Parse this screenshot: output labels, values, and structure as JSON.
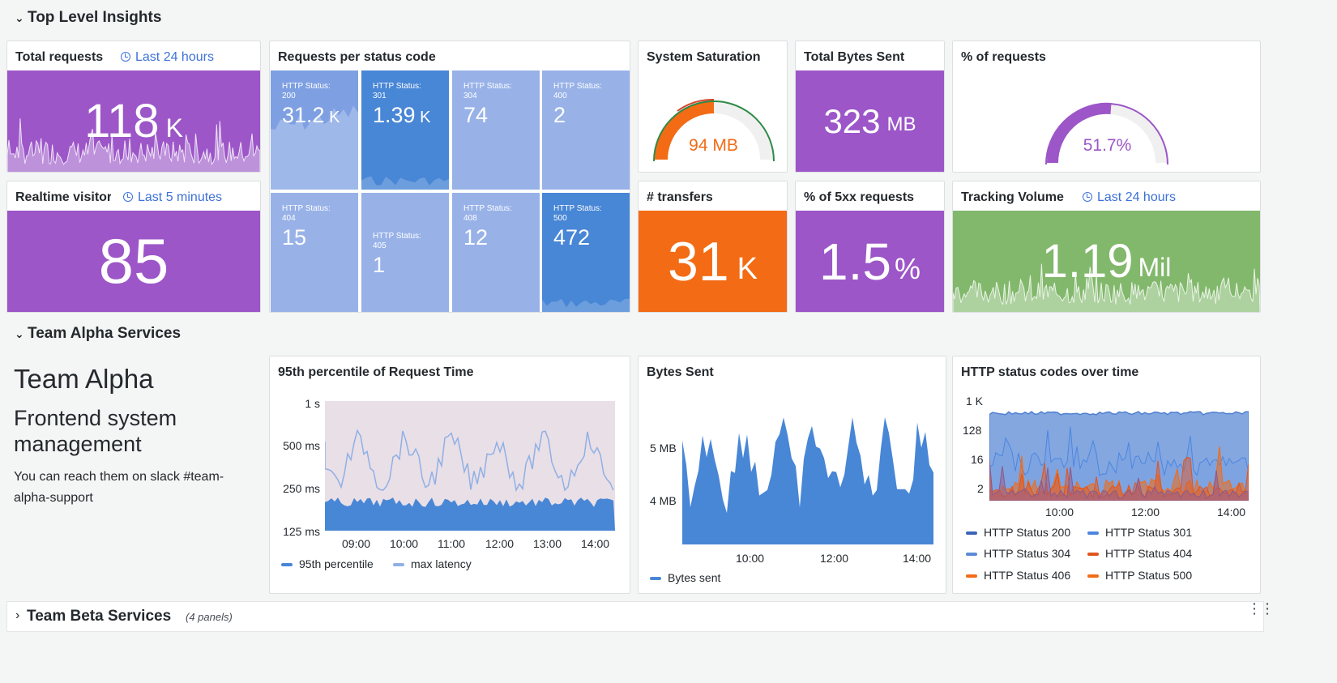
{
  "rows": {
    "top": "Top Level Insights",
    "alpha": "Team Alpha Services",
    "beta": "Team Beta Services",
    "beta_count": "(4 panels)"
  },
  "colors": {
    "purple": "#9c56c8",
    "orange": "#f36b14",
    "green": "#82b86c",
    "blue_dark": "#4886d6",
    "blue_light": "#98b2e8",
    "link_blue": "#3d71d9"
  },
  "panels": {
    "total_requests": {
      "title": "Total requests",
      "time": "Last 24 hours",
      "value": "118",
      "unit": "K"
    },
    "realtime": {
      "title": "Realtime visitors",
      "time": "Last 5 minutes",
      "value": "85"
    },
    "status_codes": {
      "title": "Requests per status code",
      "tiles": [
        {
          "label": "HTTP Status:",
          "code": "200",
          "value": "31.2",
          "unit": "K"
        },
        {
          "label": "HTTP Status:",
          "code": "301",
          "value": "1.39",
          "unit": "K"
        },
        {
          "label": "HTTP Status:",
          "code": "304",
          "value": "74",
          "unit": ""
        },
        {
          "label": "HTTP Status:",
          "code": "400",
          "value": "2",
          "unit": ""
        },
        {
          "label": "HTTP Status:",
          "code": "404",
          "value": "15",
          "unit": ""
        },
        {
          "label": "HTTP Status:",
          "code": "405",
          "value": "1",
          "unit": ""
        },
        {
          "label": "HTTP Status:",
          "code": "408",
          "value": "12",
          "unit": ""
        },
        {
          "label": "HTTP Status:",
          "code": "500",
          "value": "472",
          "unit": ""
        }
      ]
    },
    "saturation": {
      "title": "System Saturation",
      "value": "94 MB"
    },
    "bytes_total": {
      "title": "Total Bytes Sent",
      "value": "323",
      "unit": "MB"
    },
    "pct_requests": {
      "title": "% of requests",
      "value": "51.7%"
    },
    "transfers": {
      "title": "# transfers",
      "value": "31",
      "unit": "K"
    },
    "pct_5xx": {
      "title": "% of 5xx requests",
      "value": "1.5",
      "unit": "%"
    },
    "tracking": {
      "title": "Tracking Volume",
      "time": "Last 24 hours",
      "value": "1.19",
      "unit": "Mil"
    }
  },
  "team_alpha": {
    "heading": "Team Alpha",
    "subheading": "Frontend system management",
    "body": "You can reach them on slack #team-alpha-support"
  },
  "charts": {
    "p95": {
      "title": "95th percentile of Request Time",
      "yticks": [
        "1 s",
        "500 ms",
        "250 ms",
        "125 ms"
      ],
      "xticks": [
        "09:00",
        "10:00",
        "11:00",
        "12:00",
        "13:00",
        "14:00"
      ],
      "legend": [
        "95th percentile",
        "max latency"
      ]
    },
    "bytes": {
      "title": "Bytes Sent",
      "yticks": [
        "5 MB",
        "4 MB"
      ],
      "xticks": [
        "10:00",
        "12:00",
        "14:00"
      ],
      "legend": [
        "Bytes sent"
      ]
    },
    "http": {
      "title": "HTTP status codes over time",
      "yticks": [
        "1 K",
        "128",
        "16",
        "2"
      ],
      "xticks": [
        "10:00",
        "12:00",
        "14:00"
      ],
      "legend": [
        "HTTP Status 200",
        "HTTP Status 301",
        "HTTP Status 304",
        "HTTP Status 404",
        "HTTP Status 406",
        "HTTP Status 500"
      ]
    }
  },
  "chart_data": [
    {
      "type": "line",
      "title": "95th percentile of Request Time",
      "yscale": "log",
      "ylim": [
        "125 ms",
        "1 s"
      ],
      "x": [
        "09:00",
        "10:00",
        "11:00",
        "12:00",
        "13:00",
        "14:00"
      ],
      "series": [
        {
          "name": "95th percentile",
          "values": [
            "190 ms",
            "200 ms",
            "190 ms",
            "180 ms",
            "185 ms",
            "190 ms"
          ]
        },
        {
          "name": "max latency",
          "values": [
            "450 ms",
            "600 ms",
            "500 ms",
            "550 ms",
            "600 ms",
            "500 ms"
          ]
        }
      ]
    },
    {
      "type": "area",
      "title": "Bytes Sent",
      "x": [
        "10:00",
        "12:00",
        "14:00"
      ],
      "series": [
        {
          "name": "Bytes sent",
          "values": [
            "4.6 MB",
            "4.8 MB",
            "5.0 MB"
          ]
        }
      ]
    },
    {
      "type": "area",
      "title": "HTTP status codes over time",
      "yscale": "log",
      "x": [
        "10:00",
        "12:00",
        "14:00"
      ],
      "series": [
        {
          "name": "HTTP Status 200",
          "values": [
            700,
            700,
            700
          ]
        },
        {
          "name": "HTTP Status 301",
          "values": [
            30,
            40,
            30
          ]
        },
        {
          "name": "HTTP Status 304",
          "values": [
            4,
            6,
            4
          ]
        },
        {
          "name": "HTTP Status 404",
          "values": [
            3,
            4,
            3
          ]
        },
        {
          "name": "HTTP Status 406",
          "values": [
            2,
            3,
            2
          ]
        },
        {
          "name": "HTTP Status 500",
          "values": [
            5,
            8,
            6
          ]
        }
      ]
    }
  ]
}
